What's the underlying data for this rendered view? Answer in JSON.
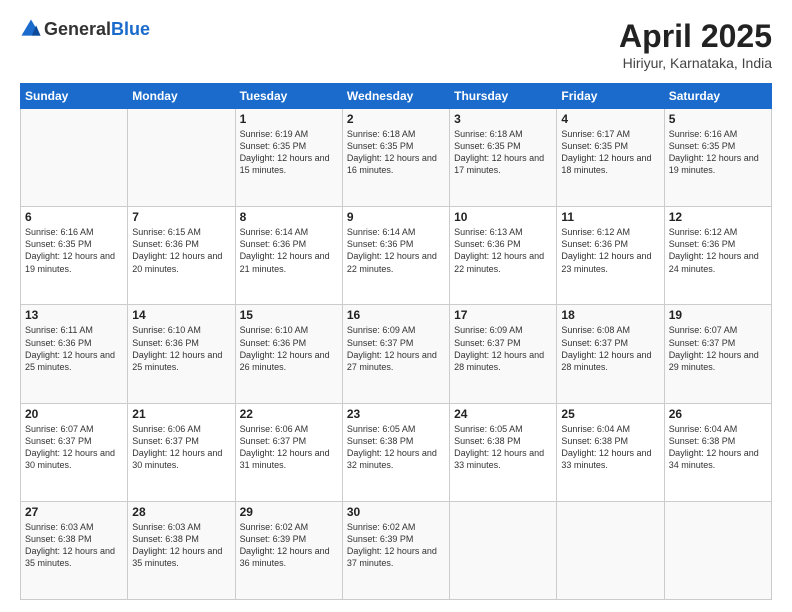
{
  "header": {
    "logo_general": "General",
    "logo_blue": "Blue",
    "title": "April 2025",
    "location": "Hiriyur, Karnataka, India"
  },
  "columns": [
    "Sunday",
    "Monday",
    "Tuesday",
    "Wednesday",
    "Thursday",
    "Friday",
    "Saturday"
  ],
  "weeks": [
    [
      {
        "day": "",
        "info": ""
      },
      {
        "day": "",
        "info": ""
      },
      {
        "day": "1",
        "info": "Sunrise: 6:19 AM\nSunset: 6:35 PM\nDaylight: 12 hours and 15 minutes."
      },
      {
        "day": "2",
        "info": "Sunrise: 6:18 AM\nSunset: 6:35 PM\nDaylight: 12 hours and 16 minutes."
      },
      {
        "day": "3",
        "info": "Sunrise: 6:18 AM\nSunset: 6:35 PM\nDaylight: 12 hours and 17 minutes."
      },
      {
        "day": "4",
        "info": "Sunrise: 6:17 AM\nSunset: 6:35 PM\nDaylight: 12 hours and 18 minutes."
      },
      {
        "day": "5",
        "info": "Sunrise: 6:16 AM\nSunset: 6:35 PM\nDaylight: 12 hours and 19 minutes."
      }
    ],
    [
      {
        "day": "6",
        "info": "Sunrise: 6:16 AM\nSunset: 6:35 PM\nDaylight: 12 hours and 19 minutes."
      },
      {
        "day": "7",
        "info": "Sunrise: 6:15 AM\nSunset: 6:36 PM\nDaylight: 12 hours and 20 minutes."
      },
      {
        "day": "8",
        "info": "Sunrise: 6:14 AM\nSunset: 6:36 PM\nDaylight: 12 hours and 21 minutes."
      },
      {
        "day": "9",
        "info": "Sunrise: 6:14 AM\nSunset: 6:36 PM\nDaylight: 12 hours and 22 minutes."
      },
      {
        "day": "10",
        "info": "Sunrise: 6:13 AM\nSunset: 6:36 PM\nDaylight: 12 hours and 22 minutes."
      },
      {
        "day": "11",
        "info": "Sunrise: 6:12 AM\nSunset: 6:36 PM\nDaylight: 12 hours and 23 minutes."
      },
      {
        "day": "12",
        "info": "Sunrise: 6:12 AM\nSunset: 6:36 PM\nDaylight: 12 hours and 24 minutes."
      }
    ],
    [
      {
        "day": "13",
        "info": "Sunrise: 6:11 AM\nSunset: 6:36 PM\nDaylight: 12 hours and 25 minutes."
      },
      {
        "day": "14",
        "info": "Sunrise: 6:10 AM\nSunset: 6:36 PM\nDaylight: 12 hours and 25 minutes."
      },
      {
        "day": "15",
        "info": "Sunrise: 6:10 AM\nSunset: 6:36 PM\nDaylight: 12 hours and 26 minutes."
      },
      {
        "day": "16",
        "info": "Sunrise: 6:09 AM\nSunset: 6:37 PM\nDaylight: 12 hours and 27 minutes."
      },
      {
        "day": "17",
        "info": "Sunrise: 6:09 AM\nSunset: 6:37 PM\nDaylight: 12 hours and 28 minutes."
      },
      {
        "day": "18",
        "info": "Sunrise: 6:08 AM\nSunset: 6:37 PM\nDaylight: 12 hours and 28 minutes."
      },
      {
        "day": "19",
        "info": "Sunrise: 6:07 AM\nSunset: 6:37 PM\nDaylight: 12 hours and 29 minutes."
      }
    ],
    [
      {
        "day": "20",
        "info": "Sunrise: 6:07 AM\nSunset: 6:37 PM\nDaylight: 12 hours and 30 minutes."
      },
      {
        "day": "21",
        "info": "Sunrise: 6:06 AM\nSunset: 6:37 PM\nDaylight: 12 hours and 30 minutes."
      },
      {
        "day": "22",
        "info": "Sunrise: 6:06 AM\nSunset: 6:37 PM\nDaylight: 12 hours and 31 minutes."
      },
      {
        "day": "23",
        "info": "Sunrise: 6:05 AM\nSunset: 6:38 PM\nDaylight: 12 hours and 32 minutes."
      },
      {
        "day": "24",
        "info": "Sunrise: 6:05 AM\nSunset: 6:38 PM\nDaylight: 12 hours and 33 minutes."
      },
      {
        "day": "25",
        "info": "Sunrise: 6:04 AM\nSunset: 6:38 PM\nDaylight: 12 hours and 33 minutes."
      },
      {
        "day": "26",
        "info": "Sunrise: 6:04 AM\nSunset: 6:38 PM\nDaylight: 12 hours and 34 minutes."
      }
    ],
    [
      {
        "day": "27",
        "info": "Sunrise: 6:03 AM\nSunset: 6:38 PM\nDaylight: 12 hours and 35 minutes."
      },
      {
        "day": "28",
        "info": "Sunrise: 6:03 AM\nSunset: 6:38 PM\nDaylight: 12 hours and 35 minutes."
      },
      {
        "day": "29",
        "info": "Sunrise: 6:02 AM\nSunset: 6:39 PM\nDaylight: 12 hours and 36 minutes."
      },
      {
        "day": "30",
        "info": "Sunrise: 6:02 AM\nSunset: 6:39 PM\nDaylight: 12 hours and 37 minutes."
      },
      {
        "day": "",
        "info": ""
      },
      {
        "day": "",
        "info": ""
      },
      {
        "day": "",
        "info": ""
      }
    ]
  ]
}
